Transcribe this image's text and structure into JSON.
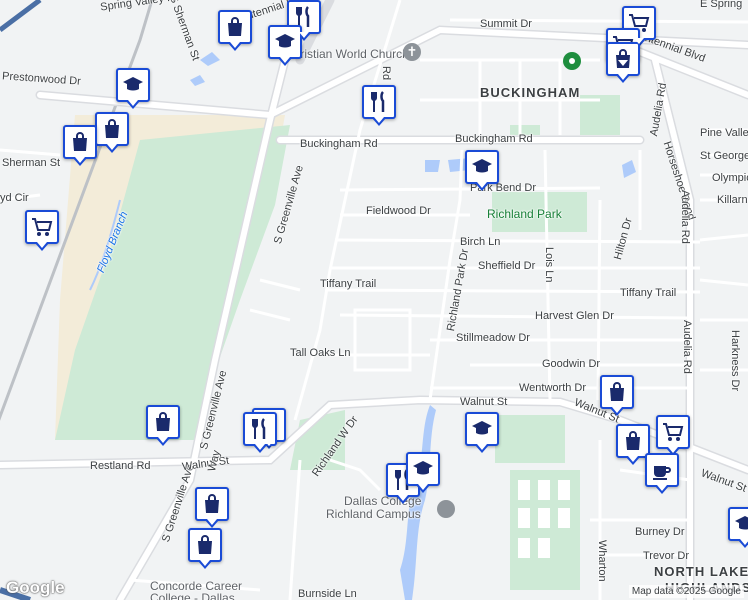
{
  "map": {
    "attribution": "Map data ©2025 Google",
    "logo": "Google",
    "colors": {
      "road": "#ffffff",
      "major": "#dadce0",
      "park": "#ceead6",
      "water": "#aecbfa",
      "pin_border": "#1a4bd6",
      "land": "#f1f3f4",
      "sand": "#f3ecd9"
    },
    "labels": [
      {
        "id": "summit-dr",
        "text": "Summit Dr"
      },
      {
        "id": "centennial-blvd",
        "text": "Centennial Blvd"
      },
      {
        "id": "centennial-blvd-2",
        "text": "Centennial Blvd"
      },
      {
        "id": "e-spring",
        "text": "E Spring"
      },
      {
        "id": "church",
        "text": "Christian World Church"
      },
      {
        "id": "buckingham",
        "text": "BUCKINGHAM"
      },
      {
        "id": "prestonwood-dr",
        "text": "Prestonwood Dr"
      },
      {
        "id": "s-sherman-st",
        "text": "S Sherman St"
      },
      {
        "id": "spring-valley",
        "text": "Spring Valley Rd"
      },
      {
        "id": "buckingham-rd",
        "text": "Buckingham Rd"
      },
      {
        "id": "buckingham-rd-2",
        "text": "Buckingham Rd"
      },
      {
        "id": "sherman-st",
        "text": "Sherman St"
      },
      {
        "id": "pine-valley",
        "text": "Pine Valley"
      },
      {
        "id": "st-george",
        "text": "St George"
      },
      {
        "id": "olympic",
        "text": "Olympic"
      },
      {
        "id": "killarney",
        "text": "Killarn"
      },
      {
        "id": "horseshoe-bend",
        "text": "Horseshoe Bend"
      },
      {
        "id": "audelia-rd",
        "text": "Audelia Rd"
      },
      {
        "id": "audelia-rd-2",
        "text": "Audelia Rd"
      },
      {
        "id": "audelia-rd-3",
        "text": "Audelia Rd"
      },
      {
        "id": "park-bend-dr",
        "text": "Park Bend Dr"
      },
      {
        "id": "fieldwood-dr",
        "text": "Fieldwood Dr"
      },
      {
        "id": "richland-park",
        "text": "Richland Park"
      },
      {
        "id": "floyd-cir",
        "text": "yd Cir"
      },
      {
        "id": "floyd-branch",
        "text": "Floyd Branch"
      },
      {
        "id": "birch-ln",
        "text": "Birch Ln"
      },
      {
        "id": "sheffield-dr",
        "text": "Sheffield Dr"
      },
      {
        "id": "lois-ln",
        "text": "Lois Ln"
      },
      {
        "id": "hilton-dr",
        "text": "Hilton Dr"
      },
      {
        "id": "tiffany-trail",
        "text": "Tiffany Trail"
      },
      {
        "id": "tiffany-trail-2",
        "text": "Tiffany Trail"
      },
      {
        "id": "richland-park-dr",
        "text": "Richland Park Dr"
      },
      {
        "id": "harvest-glen-dr",
        "text": "Harvest Glen Dr"
      },
      {
        "id": "stillmeadow-dr",
        "text": "Stillmeadow Dr"
      },
      {
        "id": "harkness-dr",
        "text": "Harkness Dr"
      },
      {
        "id": "s-greenville-ave",
        "text": "S Greenville Ave"
      },
      {
        "id": "s-greenville-ave-2",
        "text": "S Greenville Ave"
      },
      {
        "id": "s-greenville-ave-3",
        "text": "S Greenville Ave"
      },
      {
        "id": "tall-oaks-ln",
        "text": "Tall Oaks Ln"
      },
      {
        "id": "goodwin-dr",
        "text": "Goodwin Dr"
      },
      {
        "id": "wentworth-dr",
        "text": "Wentworth Dr"
      },
      {
        "id": "walnut-st",
        "text": "Walnut St"
      },
      {
        "id": "walnut-st-2",
        "text": "Walnut St"
      },
      {
        "id": "walnut-st-3",
        "text": "Walnut St"
      },
      {
        "id": "walnut-st-4",
        "text": "Walnut St"
      },
      {
        "id": "restland-rd",
        "text": "Restland Rd"
      },
      {
        "id": "richland-w-dr",
        "text": "Richland W Dr"
      },
      {
        "id": "dallas-college",
        "text": "Dallas College"
      },
      {
        "id": "richland-campus",
        "text": "Richland Campus"
      },
      {
        "id": "burney-dr",
        "text": "Burney Dr"
      },
      {
        "id": "trevor-dr",
        "text": "Trevor Dr"
      },
      {
        "id": "wharton",
        "text": "Wharton"
      },
      {
        "id": "north-lake",
        "text": "NORTH LAKE"
      },
      {
        "id": "highlands",
        "text": "HIGHLANDS"
      },
      {
        "id": "concorde-1",
        "text": "Concorde Career"
      },
      {
        "id": "concorde-2",
        "text": "College - Dallas"
      },
      {
        "id": "way",
        "text": "Way"
      },
      {
        "id": "burnside",
        "text": "Burnside Ln"
      },
      {
        "id": "rd-vert",
        "text": "Rd"
      }
    ],
    "pins": [
      {
        "id": "p1",
        "icon": "shopping-bag-icon"
      },
      {
        "id": "p2",
        "icon": "restaurant-icon"
      },
      {
        "id": "p3",
        "icon": "school-icon"
      },
      {
        "id": "p4",
        "icon": "shopping-cart-icon"
      },
      {
        "id": "p5",
        "icon": "shopping-cart-icon"
      },
      {
        "id": "p6",
        "icon": "shopping-bag-icon"
      },
      {
        "id": "p7",
        "icon": "school-icon"
      },
      {
        "id": "p8",
        "icon": "restaurant-icon"
      },
      {
        "id": "p9",
        "icon": "shopping-bag-icon"
      },
      {
        "id": "p10",
        "icon": "shopping-bag-icon"
      },
      {
        "id": "p11",
        "icon": "school-icon"
      },
      {
        "id": "p12",
        "icon": "shopping-cart-icon"
      },
      {
        "id": "p13",
        "icon": "shopping-bag-icon"
      },
      {
        "id": "p14",
        "icon": "restaurant-icon"
      },
      {
        "id": "p15",
        "icon": "restaurant-icon"
      },
      {
        "id": "p16",
        "icon": "school-icon"
      },
      {
        "id": "p17",
        "icon": "shopping-bag-icon"
      },
      {
        "id": "p18",
        "icon": "shopping-cart-icon"
      },
      {
        "id": "p19",
        "icon": "shopping-bag-icon"
      },
      {
        "id": "p20",
        "icon": "coffee-icon"
      },
      {
        "id": "p21",
        "icon": "restaurant-icon"
      },
      {
        "id": "p22",
        "icon": "school-icon"
      },
      {
        "id": "p23",
        "icon": "shopping-bag-icon"
      },
      {
        "id": "p24",
        "icon": "shopping-bag-icon"
      },
      {
        "id": "p25",
        "icon": "school-icon"
      }
    ]
  }
}
